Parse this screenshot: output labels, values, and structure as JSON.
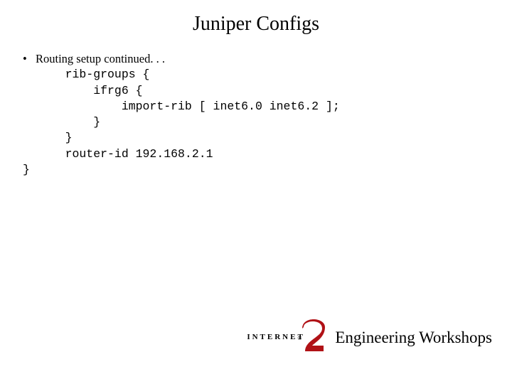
{
  "title": "Juniper Configs",
  "bullet_lead": "Routing setup continued. . .",
  "code_lines": [
    "    rib-groups {",
    "        ifrg6 {",
    "            import-rib [ inet6.0 inet6.2 ];",
    "        }",
    "    }",
    "    router-id 192.168.2.1"
  ],
  "code_close": "}",
  "logo": {
    "word": "INTERNET",
    "reg": "®"
  },
  "footer_text": "Engineering Workshops"
}
